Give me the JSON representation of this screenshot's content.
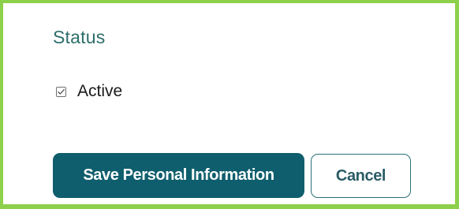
{
  "status_section": {
    "title": "Status",
    "checkbox": {
      "label": "Active",
      "checked": true,
      "icon": "checkmark-icon"
    }
  },
  "actions": {
    "save_label": "Save Personal Information",
    "cancel_label": "Cancel"
  },
  "colors": {
    "frame_border": "#8cd04b",
    "title_text": "#2d6e6a",
    "primary_button": "#0f5e6d",
    "secondary_border": "#2b6f78"
  }
}
